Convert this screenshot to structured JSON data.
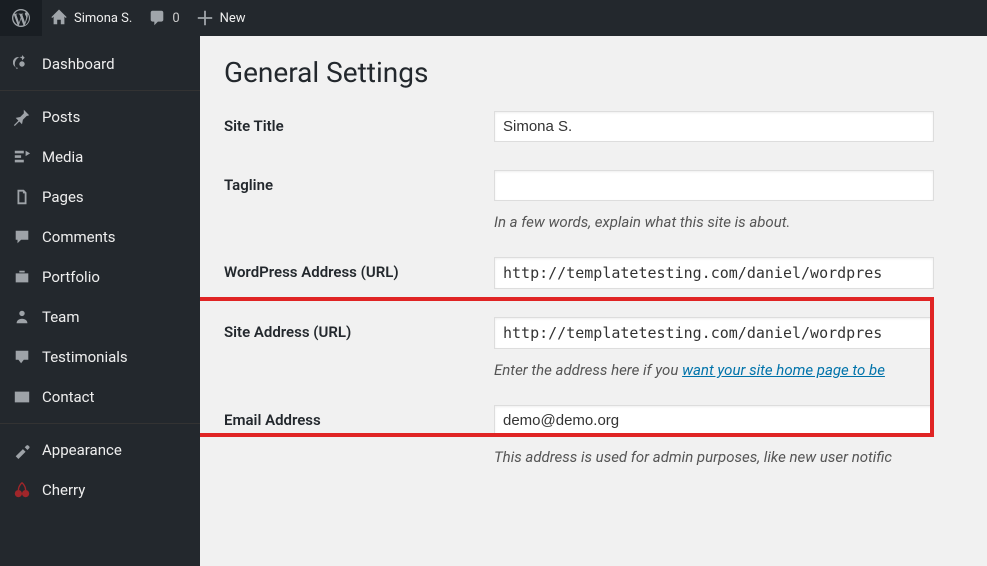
{
  "adminbar": {
    "site_name": "Simona S.",
    "comments_count": "0",
    "new_label": "New"
  },
  "sidebar": {
    "items": [
      {
        "label": "Dashboard",
        "icon": "dashboard-icon"
      },
      {
        "label": "Posts",
        "icon": "pin-icon"
      },
      {
        "label": "Media",
        "icon": "media-icon"
      },
      {
        "label": "Pages",
        "icon": "pages-icon"
      },
      {
        "label": "Comments",
        "icon": "comment-icon"
      },
      {
        "label": "Portfolio",
        "icon": "portfolio-icon"
      },
      {
        "label": "Team",
        "icon": "team-icon"
      },
      {
        "label": "Testimonials",
        "icon": "testimonials-icon"
      },
      {
        "label": "Contact",
        "icon": "contact-icon"
      },
      {
        "label": "Appearance",
        "icon": "appearance-icon"
      },
      {
        "label": "Cherry",
        "icon": "cherry-icon"
      }
    ]
  },
  "page": {
    "title": "General Settings"
  },
  "form": {
    "site_title": {
      "label": "Site Title",
      "value": "Simona S."
    },
    "tagline": {
      "label": "Tagline",
      "value": "",
      "description": "In a few words, explain what this site is about."
    },
    "wp_url": {
      "label": "WordPress Address (URL)",
      "value": "http://templatetesting.com/daniel/wordpres"
    },
    "site_url": {
      "label": "Site Address (URL)",
      "value": "http://templatetesting.com/daniel/wordpres",
      "description_prefix": "Enter the address here if you ",
      "description_link": "want your site home page to be"
    },
    "email": {
      "label": "Email Address",
      "value": "demo@demo.org",
      "description": "This address is used for admin purposes, like new user notific"
    }
  }
}
